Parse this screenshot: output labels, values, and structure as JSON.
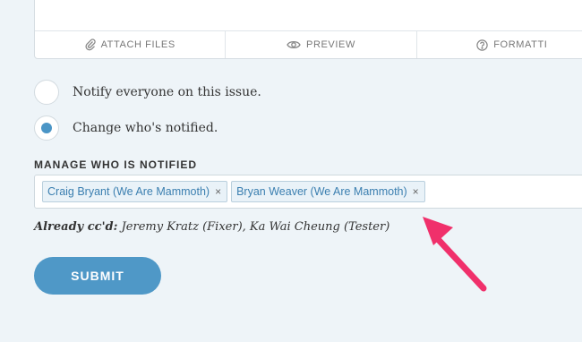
{
  "toolbar": {
    "attach_label": "ATTACH FILES",
    "preview_label": "PREVIEW",
    "format_label": "FORMATTI"
  },
  "notify": {
    "option_everyone": "Notify everyone on this issue.",
    "option_change": "Change who's notified.",
    "selected": "change"
  },
  "manage": {
    "label": "MANAGE WHO IS NOTIFIED",
    "tokens": [
      {
        "name": "Craig Bryant (We Are Mammoth)"
      },
      {
        "name": "Bryan Weaver (We Are Mammoth)"
      }
    ],
    "remove_glyph": "×"
  },
  "cc": {
    "prefix": "Already cc'd:",
    "names": "Jeremy Kratz (Fixer), Ka Wai Cheung (Tester)"
  },
  "submit_label": "SUBMIT",
  "colors": {
    "accent": "#4f98c7",
    "annotation_arrow": "#f0306b",
    "background": "#eef4f8"
  },
  "icons": [
    "paperclip-icon",
    "eye-icon",
    "help-circle-icon",
    "annotation-arrow"
  ]
}
